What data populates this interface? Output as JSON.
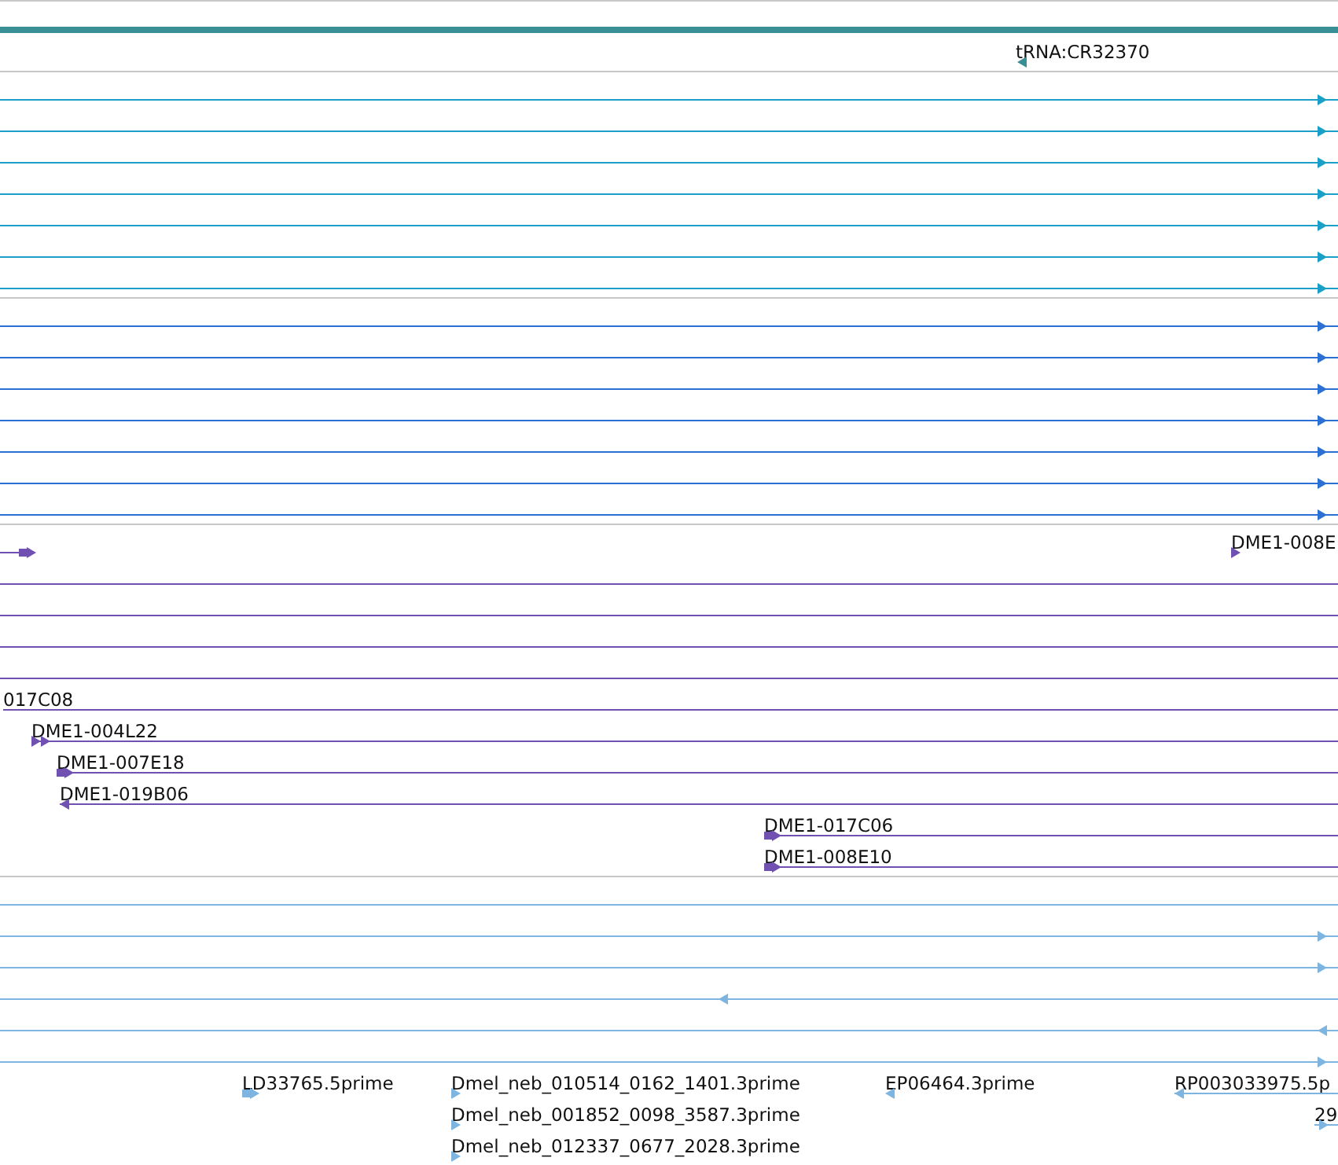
{
  "tracks": [
    {
      "color": "#3a8f96",
      "rows": [
        {
          "features": [
            {
              "label": "tRNA:CR32370",
              "arrow": true,
              "reverse": true
            }
          ]
        }
      ]
    },
    {
      "color": "#1aa0c8",
      "rows": [
        {
          "features": [
            {
              "arrow": true,
              "reverse": false
            }
          ]
        },
        {
          "features": [
            {
              "arrow": true,
              "reverse": false
            }
          ]
        },
        {
          "features": [
            {
              "arrow": true,
              "reverse": false
            }
          ]
        },
        {
          "features": [
            {
              "arrow": true,
              "reverse": false
            }
          ]
        },
        {
          "features": [
            {
              "arrow": true,
              "reverse": false
            }
          ]
        },
        {
          "features": [
            {
              "arrow": true,
              "reverse": false
            }
          ]
        },
        {
          "features": [
            {
              "arrow": true,
              "reverse": false
            }
          ]
        }
      ]
    },
    {
      "color": "#2c70d4",
      "rows": [
        {
          "features": [
            {
              "arrow": true,
              "reverse": false
            }
          ]
        },
        {
          "features": [
            {
              "arrow": true,
              "reverse": false
            }
          ]
        },
        {
          "features": [
            {
              "arrow": true,
              "reverse": false
            }
          ]
        },
        {
          "features": [
            {
              "arrow": true,
              "reverse": false
            }
          ]
        },
        {
          "features": [
            {
              "arrow": true,
              "reverse": false
            }
          ]
        },
        {
          "features": [
            {
              "arrow": true,
              "reverse": false
            }
          ]
        },
        {
          "features": [
            {
              "arrow": true,
              "reverse": false
            }
          ]
        }
      ]
    },
    {
      "color": "#7050b0",
      "rows": [
        {
          "features": [
            {
              "arrow": true,
              "reverse": false
            },
            {
              "label": "DME1-008E",
              "arrow": true,
              "reverse": false
            }
          ]
        },
        {
          "features": [
            {
              "arrow": false
            }
          ]
        },
        {
          "features": [
            {
              "arrow": false
            }
          ]
        },
        {
          "features": [
            {
              "arrow": false
            }
          ]
        },
        {
          "features": [
            {
              "arrow": false
            }
          ]
        },
        {
          "features": [
            {
              "label": "017C08",
              "arrow": false
            }
          ]
        },
        {
          "features": [
            {
              "label": "DME1-004L22",
              "arrow": true,
              "reverse": false
            }
          ]
        },
        {
          "features": [
            {
              "label": "DME1-007E18",
              "arrow": true,
              "reverse": false
            }
          ]
        },
        {
          "features": [
            {
              "label": "DME1-019B06",
              "arrow": true,
              "reverse": true
            }
          ]
        },
        {
          "features": [
            {
              "label": "DME1-017C06",
              "arrow": true,
              "reverse": false
            }
          ]
        },
        {
          "features": [
            {
              "label": "DME1-008E10",
              "arrow": true,
              "reverse": false
            }
          ]
        }
      ]
    },
    {
      "color": "#7db5e0",
      "rows": [
        {
          "features": [
            {
              "arrow": false
            }
          ]
        },
        {
          "features": [
            {
              "arrow": true,
              "reverse": false
            }
          ]
        },
        {
          "features": [
            {
              "arrow": true,
              "reverse": false
            }
          ]
        },
        {
          "features": [
            {
              "arrow": true,
              "reverse": true
            }
          ]
        },
        {
          "features": [
            {
              "arrow": true,
              "reverse": true
            }
          ]
        },
        {
          "features": [
            {
              "arrow": true,
              "reverse": false
            }
          ]
        },
        {
          "features": [
            {
              "label": "LD33765.5prime",
              "arrow": true,
              "reverse": false
            },
            {
              "label": "Dmel_neb_010514_0162_1401.3prime",
              "arrow": true,
              "reverse": false
            },
            {
              "label": "EP06464.3prime",
              "arrow": true,
              "reverse": true
            },
            {
              "label": "RP003033975.5p",
              "arrow": true,
              "reverse": true
            }
          ]
        },
        {
          "features": [
            {
              "label": "Dmel_neb_001852_0098_3587.3prime",
              "arrow": true,
              "reverse": false
            },
            {
              "label": "29",
              "arrow": true,
              "reverse": false
            }
          ]
        },
        {
          "features": [
            {
              "label": "Dmel_neb_012337_0677_2028.3prime",
              "arrow": true,
              "reverse": false
            }
          ]
        }
      ]
    }
  ]
}
